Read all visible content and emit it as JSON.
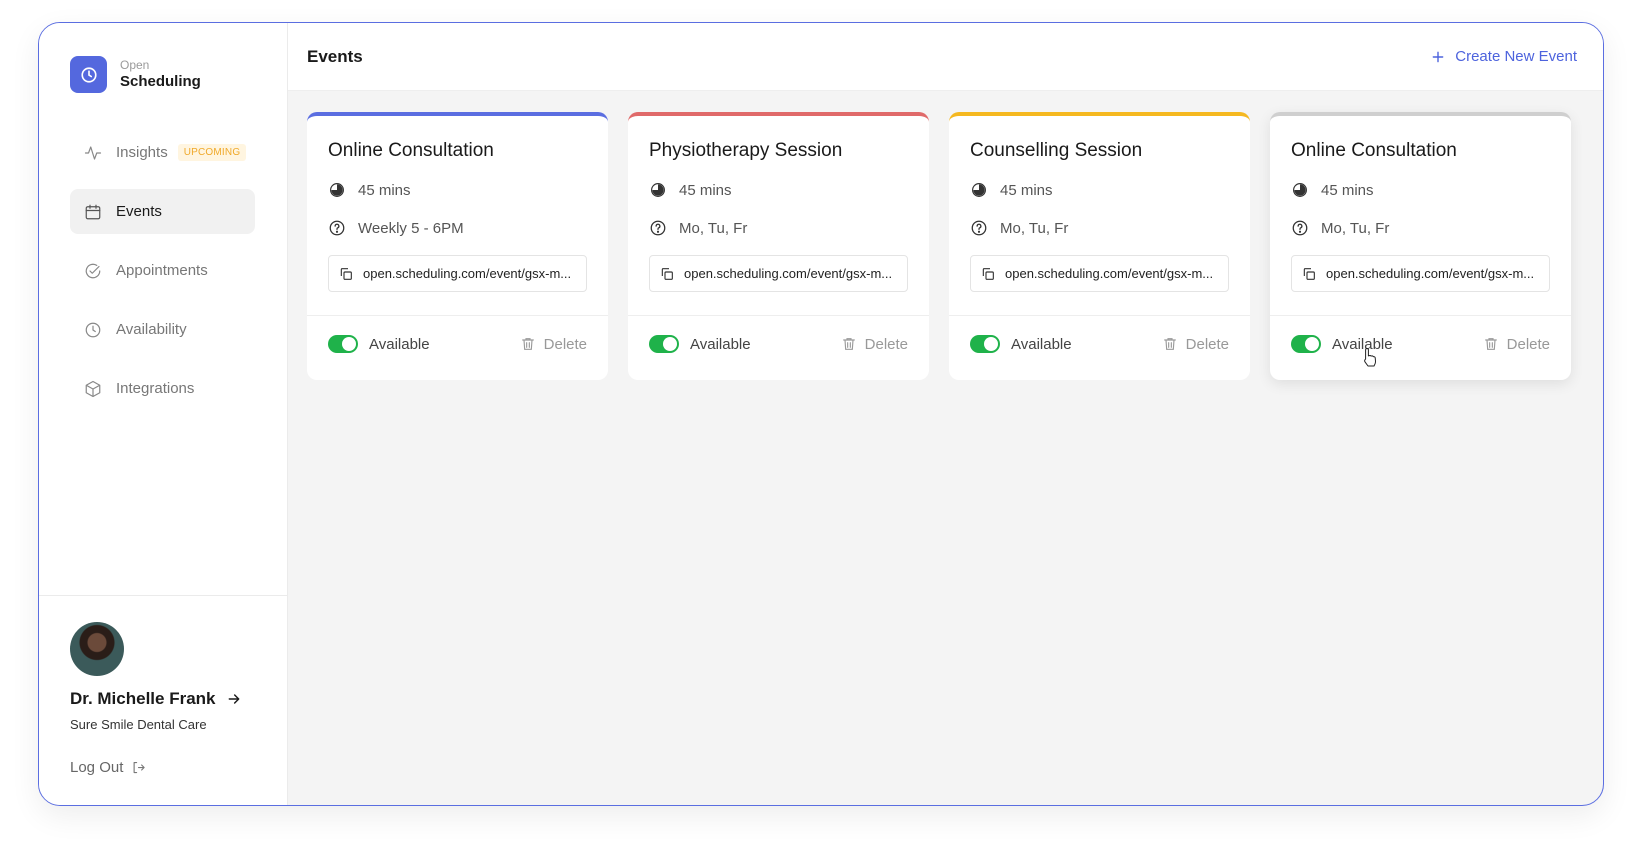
{
  "brand": {
    "top": "Open",
    "bottom": "Scheduling",
    "color": "#5468de"
  },
  "nav": [
    {
      "label": "Insights",
      "icon": "activity-icon",
      "badge": "UPCOMING",
      "active": false
    },
    {
      "label": "Events",
      "icon": "calendar-icon",
      "active": true
    },
    {
      "label": "Appointments",
      "icon": "check-circle-icon",
      "active": false
    },
    {
      "label": "Availability",
      "icon": "clock-icon",
      "active": false
    },
    {
      "label": "Integrations",
      "icon": "cube-icon",
      "active": false
    }
  ],
  "profile": {
    "name": "Dr. Michelle Frank",
    "org": "Sure Smile Dental Care",
    "logout": "Log Out"
  },
  "header": {
    "title": "Events",
    "create_label": "Create New Event"
  },
  "cards": [
    {
      "title": "Online Consultation",
      "accent": "#5b6ee1",
      "duration": "45 mins",
      "schedule": "Weekly 5 - 6PM",
      "link": "open.scheduling.com/event/gsx-m...",
      "status": "Available",
      "delete": "Delete"
    },
    {
      "title": "Physiotherapy Session",
      "accent": "#e06a6a",
      "duration": "45 mins",
      "schedule": "Mo, Tu, Fr",
      "link": "open.scheduling.com/event/gsx-m...",
      "status": "Available",
      "delete": "Delete"
    },
    {
      "title": "Counselling Session",
      "accent": "#f5b820",
      "duration": "45 mins",
      "schedule": "Mo, Tu, Fr",
      "link": "open.scheduling.com/event/gsx-m...",
      "status": "Available",
      "delete": "Delete"
    },
    {
      "title": "Online Consultation",
      "accent": "#cfcfcf",
      "duration": "45 mins",
      "schedule": "Mo, Tu, Fr",
      "link": "open.scheduling.com/event/gsx-m...",
      "status": "Available",
      "delete": "Delete"
    }
  ]
}
